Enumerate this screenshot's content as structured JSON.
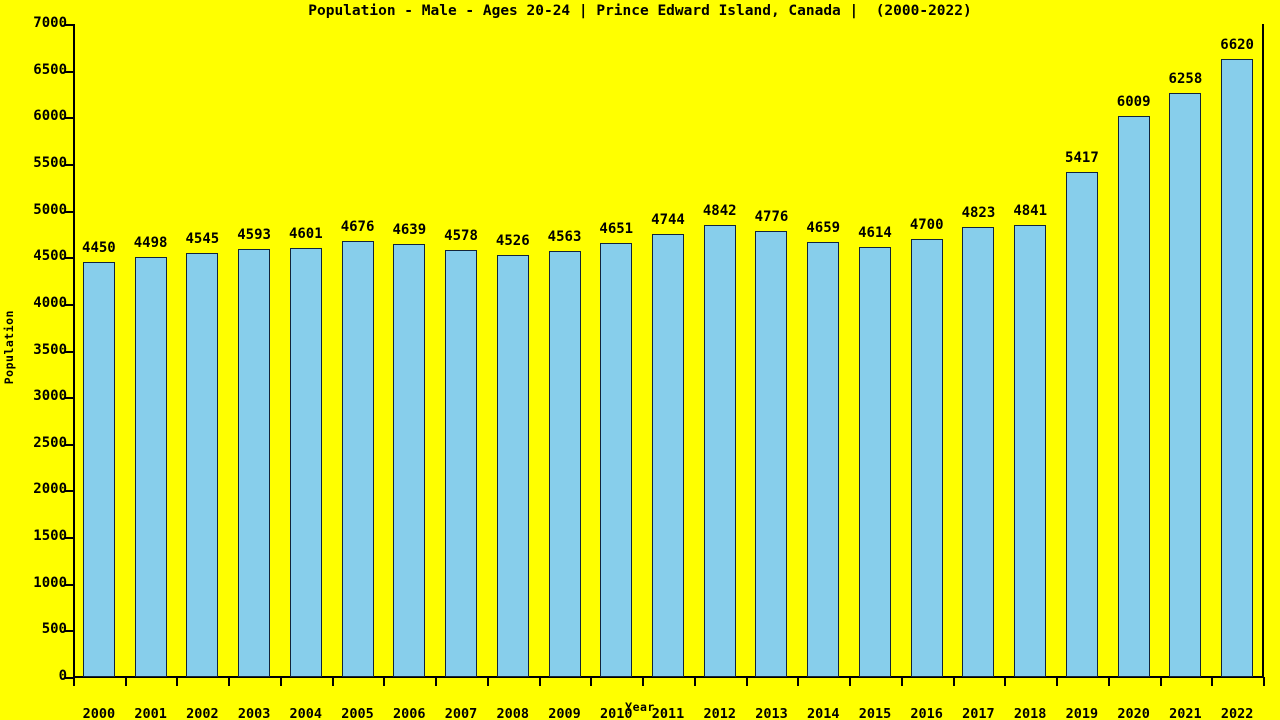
{
  "chart_data": {
    "type": "bar",
    "title": "Population - Male - Ages 20-24 | Prince Edward Island, Canada |  (2000-2022)",
    "xlabel": "Year",
    "ylabel": "Population",
    "categories": [
      "2000",
      "2001",
      "2002",
      "2003",
      "2004",
      "2005",
      "2006",
      "2007",
      "2008",
      "2009",
      "2010",
      "2011",
      "2012",
      "2013",
      "2014",
      "2015",
      "2016",
      "2017",
      "2018",
      "2019",
      "2020",
      "2021",
      "2022"
    ],
    "values": [
      4450,
      4498,
      4545,
      4593,
      4601,
      4676,
      4639,
      4578,
      4526,
      4563,
      4651,
      4744,
      4842,
      4776,
      4659,
      4614,
      4700,
      4823,
      4841,
      5417,
      6009,
      6258,
      6620
    ],
    "ylim": [
      0,
      7000
    ],
    "ytick_labels": [
      "0",
      "500",
      "1000",
      "1500",
      "2000",
      "2500",
      "3000",
      "3500",
      "4000",
      "4500",
      "5000",
      "5500",
      "6000",
      "6500",
      "7000"
    ],
    "ytick_values": [
      0,
      500,
      1000,
      1500,
      2000,
      2500,
      3000,
      3500,
      4000,
      4500,
      5000,
      5500,
      6000,
      6500,
      7000
    ],
    "grid": false,
    "legend": null,
    "data_labels": [
      "4450",
      "4498",
      "4545",
      "4593",
      "4601",
      "4676",
      "4639",
      "4578",
      "4526",
      "4563",
      "4651",
      "4744",
      "4842",
      "4776",
      "4659",
      "4614",
      "4700",
      "4823",
      "4841",
      "5417",
      "6009",
      "6258",
      "6620"
    ],
    "colors": {
      "background": "#ffff00",
      "bar_fill": "#87ceeb",
      "bar_edge": "#12243a",
      "text": "#000000",
      "axis": "#000000"
    }
  }
}
